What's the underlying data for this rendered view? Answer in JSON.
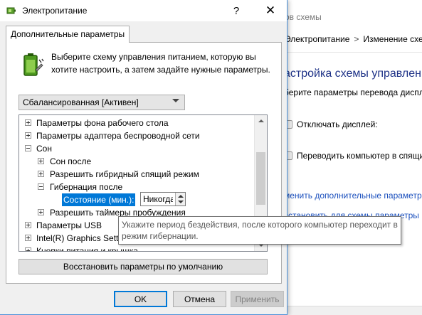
{
  "background_window": {
    "title_fragment": "ов схемы",
    "breadcrumb": [
      "Электропитание",
      "Изменение схем"
    ],
    "heading": "астройка схемы управлени",
    "subtitle": "берите параметры перевода диспл",
    "options": [
      "Отключать дисплей:",
      "Переводить компьютер в спящи"
    ],
    "links": [
      "менить дополнительные параметр",
      "сстановить для схемы параметры"
    ]
  },
  "dialog": {
    "title": "Электропитание",
    "help_glyph": "?",
    "close_glyph": "✕",
    "tab_label": "Дополнительные параметры",
    "intro_text": "Выберите схему управления питанием, которую вы хотите настроить, а затем задайте нужные параметры.",
    "scheme_selected": "Сбалансированная [Активен]",
    "tree": [
      {
        "label": "Параметры фона рабочего стола",
        "state": "collapsed"
      },
      {
        "label": "Параметры адаптера беспроводной сети",
        "state": "collapsed"
      },
      {
        "label": "Сон",
        "state": "expanded"
      },
      {
        "label": "Сон после",
        "state": "collapsed"
      },
      {
        "label": "Разрешить гибридный спящий режим",
        "state": "collapsed"
      },
      {
        "label": "Гибернация после",
        "state": "expanded"
      },
      {
        "label": "Состояние (мин.):",
        "state": "leaf"
      },
      {
        "label": "Разрешить таймеры пробуждения",
        "state": "collapsed"
      },
      {
        "label": "Параметры USB",
        "state": "collapsed"
      },
      {
        "label": "Intel(R) Graphics Setti",
        "state": "collapsed"
      },
      {
        "label": "Кнопки питания и крышка",
        "state": "collapsed"
      }
    ],
    "spin_value": "Никогда",
    "tooltip": "Укажите период бездействия, после которого компьютер переходит в режим гибернации.",
    "restore_button": "Восстановить параметры по умолчанию",
    "buttons": {
      "ok": "OK",
      "cancel": "Отмена",
      "apply": "Применить"
    }
  },
  "icons": [
    "power-options-icon",
    "battery-plug-icon",
    "chevron-down-icon",
    "expand-icon",
    "collapse-icon",
    "spin-up-icon",
    "spin-down-icon"
  ],
  "colors": {
    "selection": "#0078d7",
    "heading_blue": "#1e3287",
    "link_blue": "#1a4fbd",
    "dialog_bg": "#f0f0f0"
  }
}
